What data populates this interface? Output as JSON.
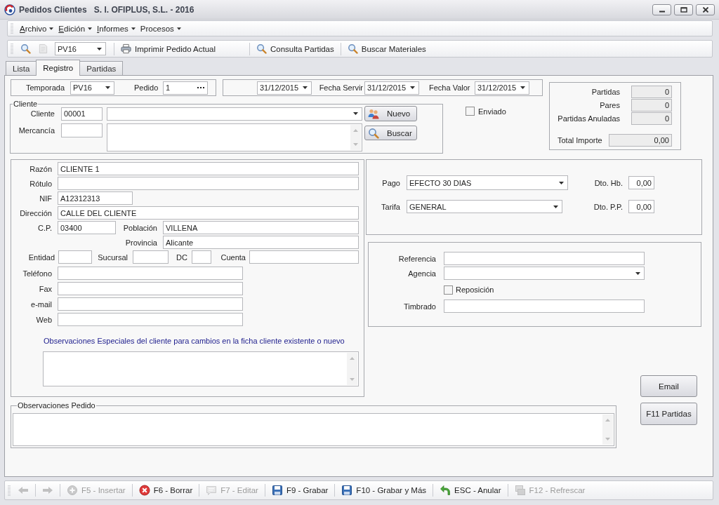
{
  "window": {
    "title": "Pedidos Clientes",
    "subtitle": "S. I. OFIPLUS, S.L. - 2016"
  },
  "menu": [
    {
      "label": "Archivo",
      "mnemonic": true
    },
    {
      "label": "Edición",
      "mnemonic": true
    },
    {
      "label": "Informes",
      "mnemonic": true
    },
    {
      "label": "Procesos",
      "mnemonic": false
    }
  ],
  "toolbar": [
    {
      "kind": "find",
      "disabled": false
    },
    {
      "kind": "document",
      "disabled": true
    },
    {
      "kind": "series",
      "value": "PV16"
    },
    {
      "kind": "print",
      "label": "Imprimir Pedido Actual"
    },
    {
      "kind": "query",
      "label": "Consulta Partidas"
    },
    {
      "kind": "materials",
      "label": "Buscar Materiales"
    }
  ],
  "tabs": [
    {
      "label": "Lista",
      "selected": false
    },
    {
      "label": "Registro",
      "selected": true
    },
    {
      "label": "Partidas",
      "selected": false
    }
  ],
  "header": {
    "temporada": {
      "label": "Temporada",
      "value": "PV16"
    },
    "pedido": {
      "label": "Pedido",
      "value": "1"
    },
    "fecha": {
      "value": "31/12/2015"
    },
    "fecha_servir": {
      "label": "Fecha Servir",
      "value": "31/12/2015"
    },
    "fecha_valor": {
      "label": "Fecha Valor",
      "value": "31/12/2015"
    }
  },
  "totals": {
    "rows": [
      {
        "label": "Partidas",
        "value": "0"
      },
      {
        "label": "Pares",
        "value": "0"
      },
      {
        "label": "Partidas Anuladas",
        "value": "0"
      }
    ],
    "total": {
      "label": "Total Importe",
      "value": "0,00"
    }
  },
  "cliente": {
    "legend": "Cliente",
    "code": {
      "label": "Cliente",
      "value": "00001"
    },
    "mercancia": {
      "label": "Mercancía"
    },
    "buttons": [
      {
        "kind": "new",
        "label": "Nuevo"
      },
      {
        "kind": "search",
        "label": "Buscar"
      }
    ]
  },
  "enviado": {
    "label": "Enviado",
    "checked": false
  },
  "datos": {
    "razon": {
      "label": "Razón",
      "value": "CLIENTE 1"
    },
    "rotulo": {
      "label": "Rótulo"
    },
    "nif": {
      "label": "NIF",
      "value": "A12312313"
    },
    "direccion": {
      "label": "Dirección",
      "value": "CALLE DEL CLIENTE"
    },
    "cp": {
      "label": "C.P.",
      "value": "03400"
    },
    "poblacion": {
      "label": "Población",
      "value": "VILLENA"
    },
    "provincia": {
      "label": "Provincia",
      "value": "Alicante"
    },
    "entidad": {
      "label": "Entidad"
    },
    "sucursal": {
      "label": "Sucursal"
    },
    "dc": {
      "label": "DC"
    },
    "cuenta": {
      "label": "Cuenta"
    },
    "telefono": {
      "label": "Teléfono"
    },
    "fax": {
      "label": "Fax"
    },
    "email": {
      "label": "e-mail"
    },
    "web": {
      "label": "Web"
    },
    "observaciones": {
      "label": "Observaciones Especiales del cliente para cambios en la ficha cliente existente o nuevo"
    }
  },
  "condiciones": {
    "pago": {
      "label": "Pago",
      "value": "EFECTO 30 DIAS"
    },
    "dto_hb": {
      "label": "Dto. Hb.",
      "value": "0,00"
    },
    "tarifa": {
      "label": "Tarifa",
      "value": "GENERAL"
    },
    "dto_pp": {
      "label": "Dto. P.P.",
      "value": "0,00"
    }
  },
  "envio": {
    "referencia": {
      "label": "Referencia"
    },
    "agencia": {
      "label": "Agencia"
    },
    "reposicion": {
      "label": "Reposición",
      "checked": false
    },
    "timbrado": {
      "label": "Timbrado"
    }
  },
  "side_buttons": [
    {
      "label": "Email"
    },
    {
      "label": "F11 Partidas"
    }
  ],
  "observaciones_pedido": {
    "legend": "Observaciones Pedido"
  },
  "bottom_toolbar": [
    {
      "kind": "back",
      "disabled": true
    },
    {
      "kind": "forward",
      "disabled": true
    },
    {
      "kind": "insert",
      "label": "F5 - Insertar",
      "disabled": true
    },
    {
      "kind": "delete",
      "label": "F6 - Borrar",
      "disabled": false
    },
    {
      "kind": "edit",
      "label": "F7 - Editar",
      "disabled": true
    },
    {
      "kind": "save",
      "label": "F9 - Grabar",
      "disabled": false
    },
    {
      "kind": "save-more",
      "label": "F10 - Grabar y Más",
      "disabled": false
    },
    {
      "kind": "cancel",
      "label": "ESC - Anular",
      "disabled": false
    },
    {
      "kind": "refresh",
      "label": "F12 - Refrescar",
      "disabled": true
    }
  ]
}
